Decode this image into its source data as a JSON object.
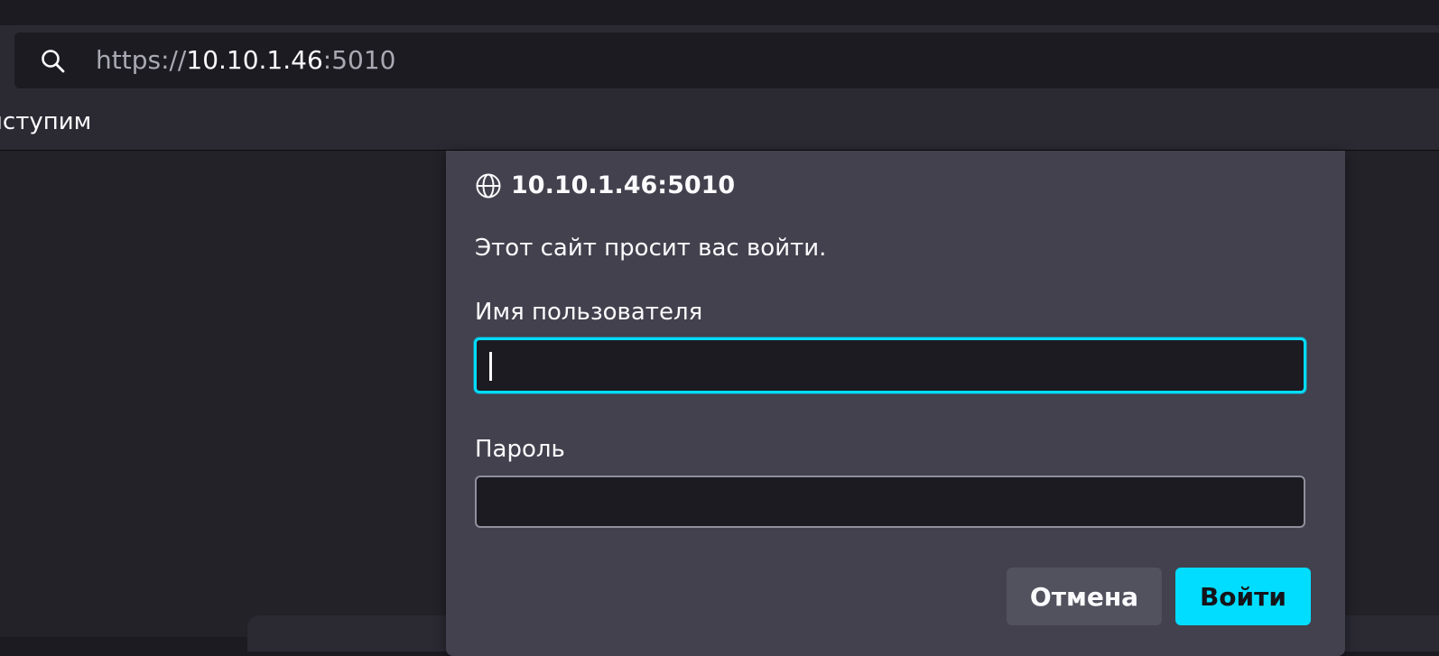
{
  "browser": {
    "url": {
      "scheme": "https://",
      "host": "10.10.1.46",
      "port": ":5010"
    },
    "bookmarks": [
      {
        "label": "иступим"
      }
    ]
  },
  "dialog": {
    "title": "10.10.1.46:5010",
    "message": "Этот сайт просит вас войти.",
    "username_label": "Имя пользователя",
    "username_value": "",
    "password_label": "Пароль",
    "password_value": "",
    "cancel_label": "Отмена",
    "login_label": "Войти"
  },
  "icons": {
    "search": "search-icon",
    "globe": "globe-icon"
  },
  "colors": {
    "accent": "#00ddff",
    "dialog_bg": "#42414d",
    "toolbar_bg": "#2b2a33",
    "field_bg": "#1c1b22"
  }
}
